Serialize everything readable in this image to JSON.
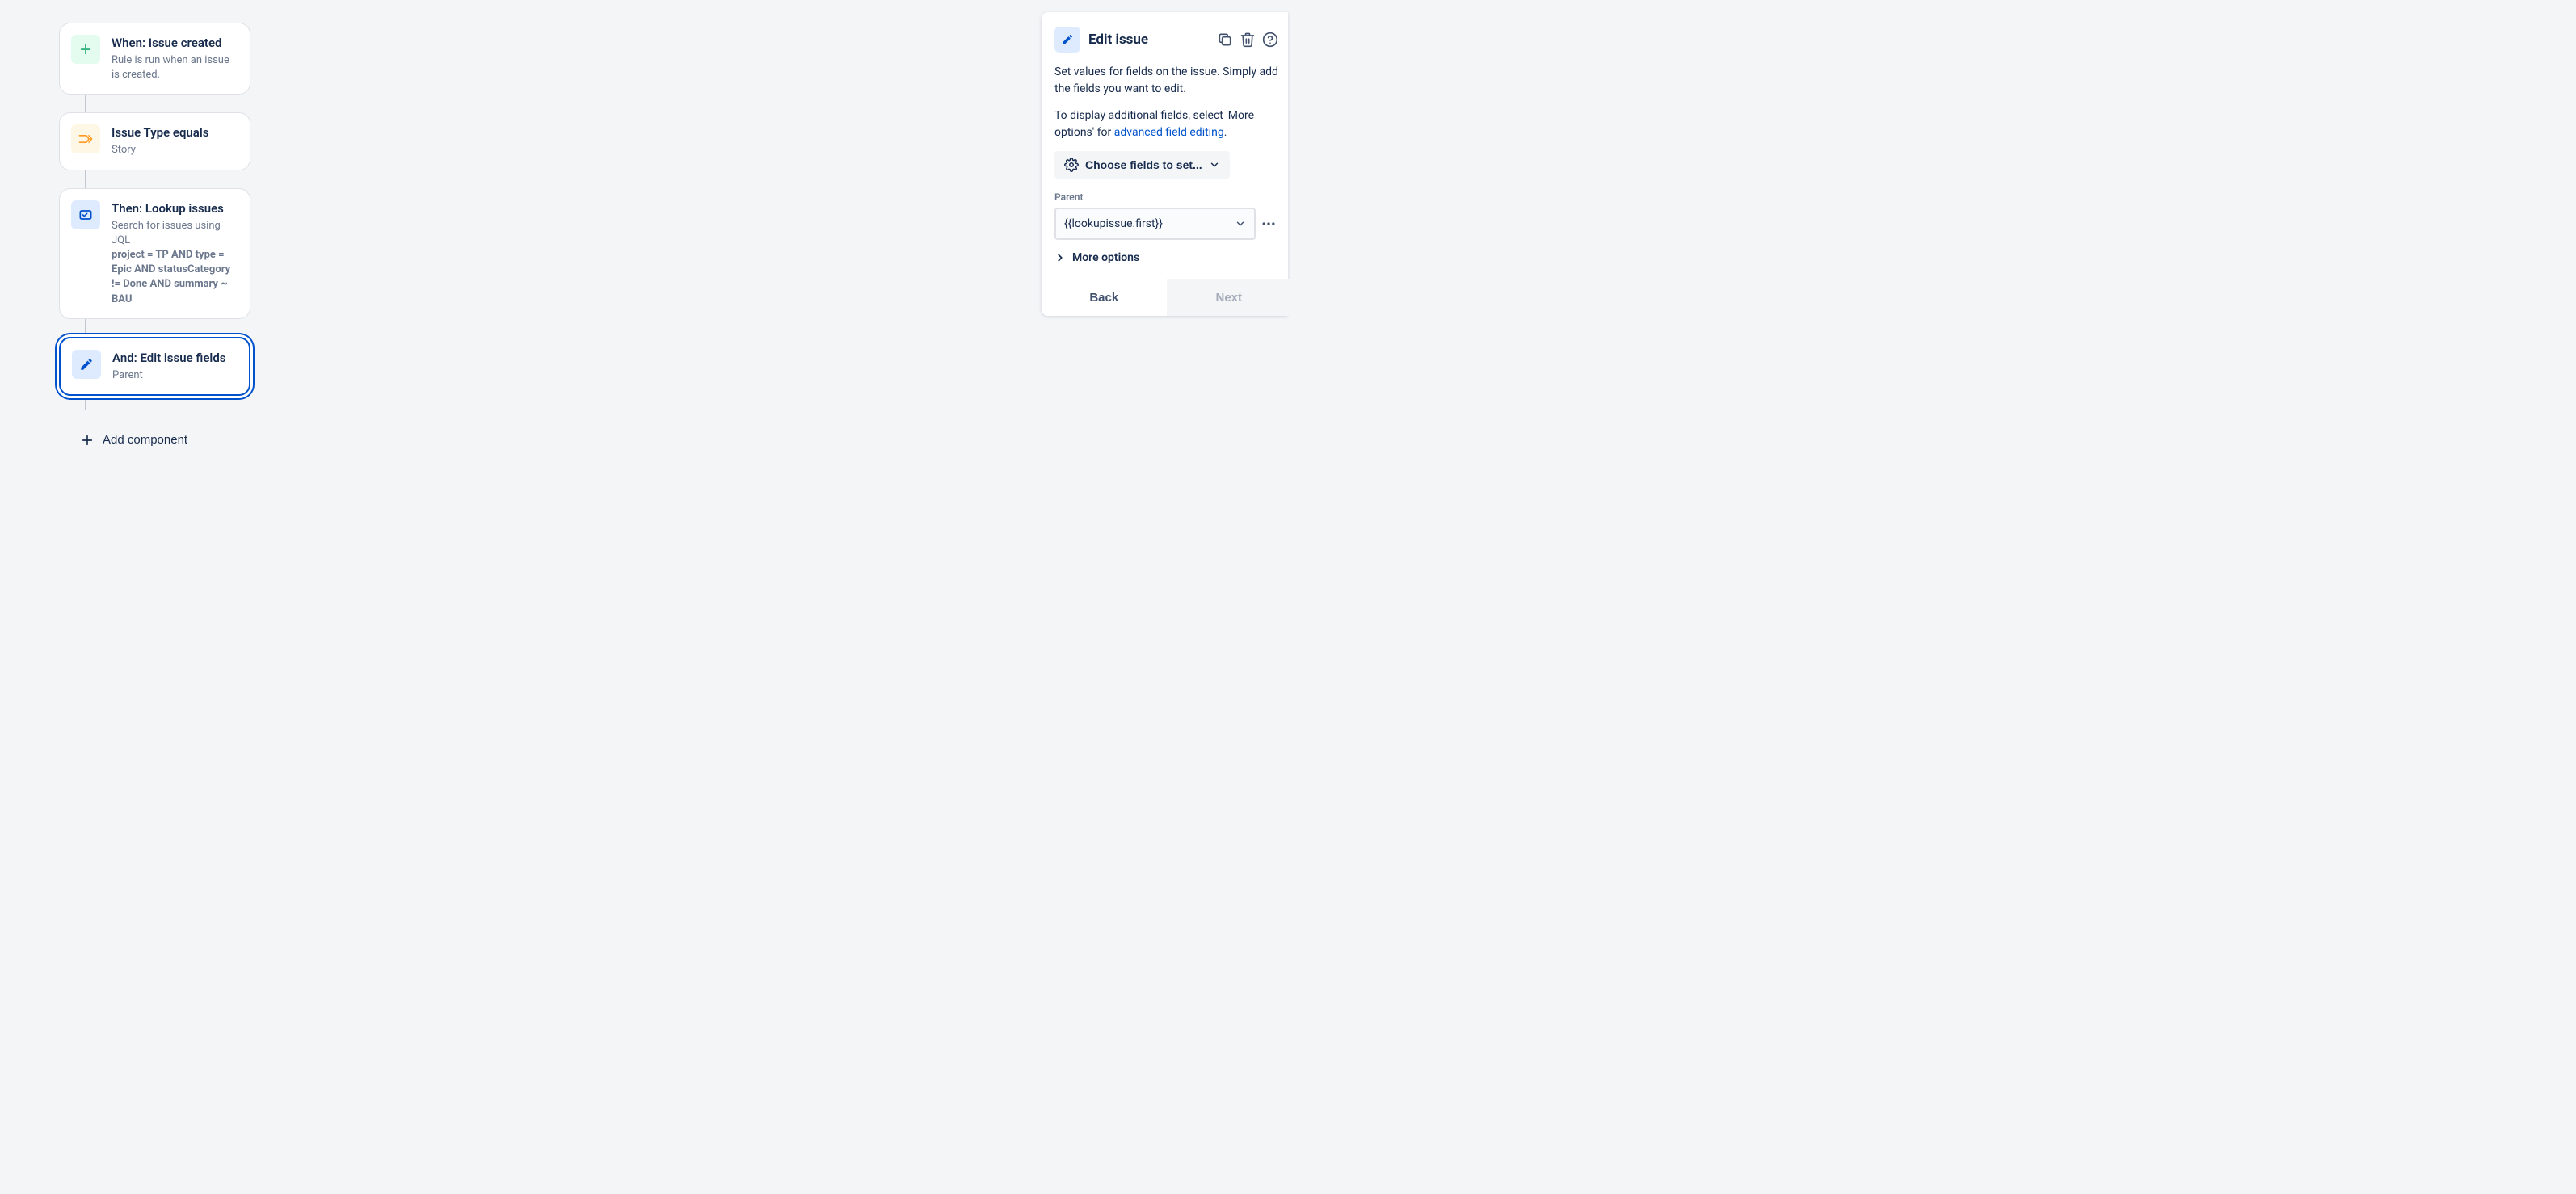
{
  "rule_chain": {
    "trigger": {
      "title": "When: Issue created",
      "sub": "Rule is run when an issue is created."
    },
    "condition": {
      "title": "Issue Type equals",
      "sub": "Story"
    },
    "lookup": {
      "title": "Then: Lookup issues",
      "sub": "Search for issues using JQL",
      "code": "project = TP AND type = Epic AND statusCategory != Done AND summary ~ BAU"
    },
    "edit": {
      "title": "And: Edit issue fields",
      "sub": "Parent"
    },
    "add_component_label": "Add component"
  },
  "panel": {
    "title": "Edit issue",
    "desc1": "Set values for fields on the issue. Simply add the fields you want to edit.",
    "desc2_prefix": "To display additional fields, select 'More options' for ",
    "desc2_link": "advanced field editing",
    "desc2_suffix": ".",
    "choose_label": "Choose fields to set...",
    "field_label": "Parent",
    "field_value": "{{lookupissue.first}}",
    "more_options_label": "More options",
    "back_label": "Back",
    "next_label": "Next"
  }
}
